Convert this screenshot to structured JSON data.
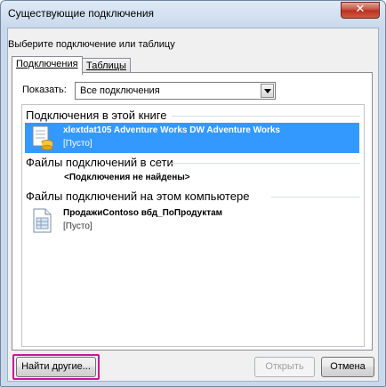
{
  "window": {
    "title": "Существующие подключения",
    "close_glyph": "✕"
  },
  "prompt": "Выберите подключение или таблицу",
  "tabs": [
    {
      "label": "Подключения",
      "active": true
    },
    {
      "label": "Таблицы",
      "active": false
    }
  ],
  "filter": {
    "label": "Показать:",
    "value": "Все подключения"
  },
  "sections": {
    "workbook": "Подключения в этой книге",
    "network": "Файлы подключений в сети",
    "computer": "Файлы подключений на этом компьютере"
  },
  "connections": {
    "workbook_item": {
      "name": "xlextdat105 Adventure Works DW Adventure Works",
      "description": "[Пусто]",
      "icon": "database-connection-icon",
      "selected": true
    },
    "network_empty": "<Подключения не найдены>",
    "computer_item": {
      "name": "ПродажиContoso вбд_ПоПродуктам",
      "description": "[Пусто]",
      "icon": "connection-file-icon"
    }
  },
  "buttons": {
    "browse": "Найти другие...",
    "open": "Открыть",
    "cancel": "Отмена"
  },
  "colors": {
    "selection": "#3399ff",
    "highlight_frame": "#c4199b",
    "close_button": "#c7463a"
  }
}
